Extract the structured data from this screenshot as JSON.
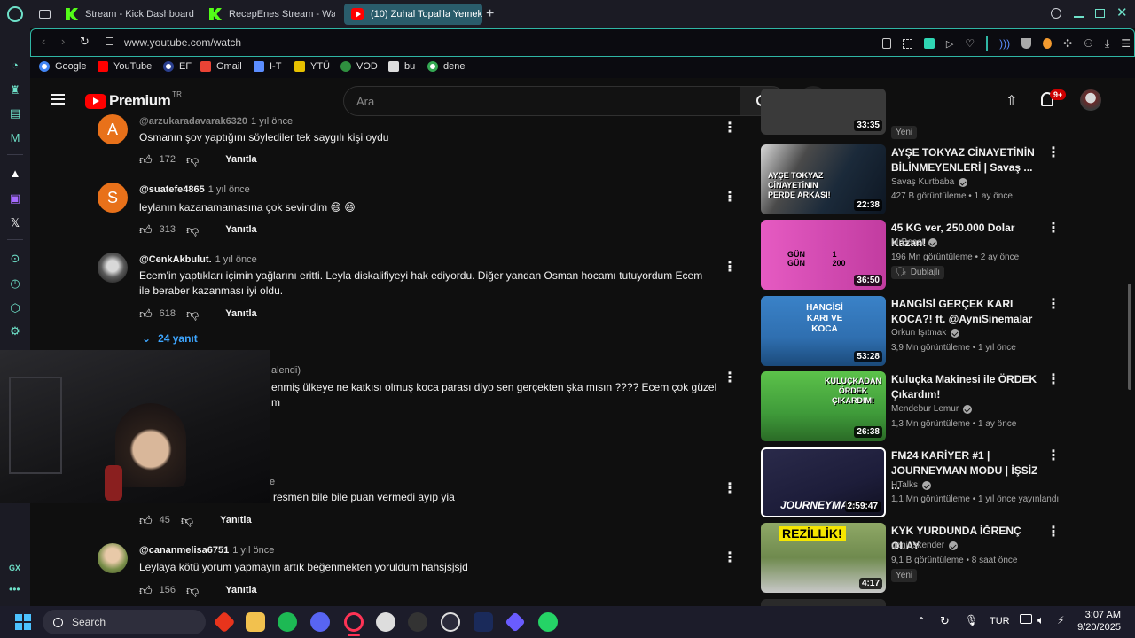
{
  "browser": {
    "tabs": [
      {
        "label": "Stream - Kick Dashboard",
        "icon": "kick-icon"
      },
      {
        "label": "RecepEnes Stream - Watc",
        "icon": "kick-icon"
      },
      {
        "label": "(10) Zuhal Topal'la Yemek",
        "icon": "youtube-icon",
        "active": true
      }
    ],
    "url": "www.youtube.com/watch",
    "bookmarks": [
      "Google",
      "YouTube",
      "EF",
      "Gmail",
      "I-T",
      "YTÜ",
      "VOD",
      "bu",
      "dene"
    ]
  },
  "youtube": {
    "logo_text": "Premium",
    "logo_region": "TR",
    "search_placeholder": "Ara",
    "notifications": "9+"
  },
  "comments": [
    {
      "handle": "@arzukaradavarak6320",
      "time": "1 yıl önce",
      "text": "Osmanın şov yaptığını söylediler tek saygılı kişi oydu",
      "likes": "172",
      "reply": "Yanıtla",
      "avatar_letter": "A",
      "avatar_color": "#e8711a"
    },
    {
      "handle": "@suatefe4865",
      "time": "1 yıl önce",
      "text": "leylanın kazanamamasına çok sevindim 😄 😄",
      "likes": "313",
      "reply": "Yanıtla",
      "avatar_letter": "S",
      "avatar_color": "#e8711a"
    },
    {
      "handle": "@CenkAkbulut.",
      "time": "1 yıl önce",
      "text": "Ecem'in yaptıkları içimin yağlarını eritti. Leyla diskalifiyeyi hak ediyordu. Diğer yandan Osman hocamı tutuyordum Ecem ile beraber kazanması iyi oldu.",
      "likes": "618",
      "reply": "Yanıtla",
      "replies": "24 yanıt"
    },
    {
      "handle": "",
      "time": "alendi)",
      "text": "enmiş ülkeye ne katkısı olmuş koca parası diyo sen gerçekten şka mısın ???? Ecem çok güzel",
      "text2": "m",
      "likes": "",
      "reply": ""
    },
    {
      "handle": "",
      "time": "e",
      "text": "resmen bile bile puan vermedi ayıp yia",
      "likes": "45",
      "reply": "Yanıtla"
    },
    {
      "handle": "@cananmelisa6751",
      "time": "1 yıl önce",
      "text": "Leylaya kötü yorum yapmayın artık beğenmekten yoruldum hahsjsjsjd",
      "likes": "156",
      "reply": "Yanıtla"
    }
  ],
  "videos": [
    {
      "duration": "33:35",
      "badge": "Yeni",
      "color": "#3a3a3a"
    },
    {
      "title": "AYŞE TOKYAZ CİNAYETİNİN BİLİNMEYENLERİ | Savaş ...",
      "channel": "Savaş Kurtbaba",
      "meta": "427 B görüntüleme • 1 ay önce",
      "duration": "22:38",
      "thumb_text": "AYŞE TOKYAZ CİNAYETİNIN PERDE ARKASI!",
      "color": "#1b2a3a"
    },
    {
      "title": "45 KG ver, 250.000 Dolar Kazan!",
      "channel": "MrBeast",
      "meta": "196 Mn görüntüleme • 2 ay önce",
      "badge": "Dublajlı",
      "duration": "36:50",
      "thumb_text": "GÜN 1 GÜN 200",
      "color": "#d34bb2"
    },
    {
      "title": "HANGİSİ GERÇEK KARI KOCA?! ft. @AyniSinemalar",
      "channel": "Orkun Işıtmak",
      "meta": "3,9 Mn görüntüleme • 1 yıl önce",
      "duration": "53:28",
      "thumb_text": "HANGİSİ KARI VE KOCA",
      "color": "#2f6fb0"
    },
    {
      "title": "Kuluçka Makinesi ile ÖRDEK Çıkardım!",
      "channel": "Mendebur Lemur",
      "meta": "1,3 Mn görüntüleme • 1 ay önce",
      "duration": "26:38",
      "thumb_text": "KULUÇKADAN ÖRDEK ÇIKARDIM!",
      "color": "#3f9b3a"
    },
    {
      "title": "FM24 KARİYER #1 | JOURNEYMAN MODU | İŞSİZ ...",
      "channel": "HTalks",
      "meta": "1,1 Mn görüntüleme • 1 yıl önce yayınlandı",
      "duration": "2:59:47",
      "thumb_text": "JOURNEYMAN",
      "color": "#1d1d3a"
    },
    {
      "title": "KYK YURDUNDA İĞRENÇ OLAY",
      "channel": "geniuskender",
      "meta": "9,1 B görüntüleme • 8 saat önce",
      "badge": "Yeni",
      "duration": "4:17",
      "thumb_text": "REZİLLİK!",
      "color": "#6f8a4e"
    }
  ],
  "taskbar": {
    "search": "Search",
    "lang": "TUR",
    "time": "3:07 AM",
    "date": "9/20/2025"
  }
}
